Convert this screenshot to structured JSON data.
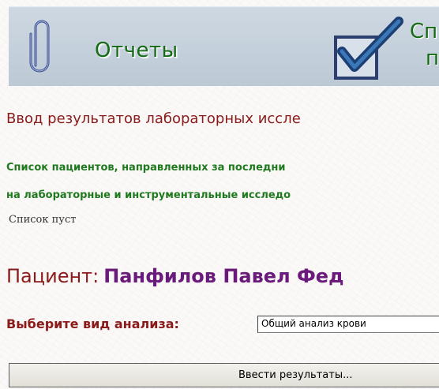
{
  "topbar": {
    "reports_label": "Отчеты",
    "list_label_line1": "Сп",
    "list_label_line2": "па"
  },
  "main": {
    "section_title": "Ввод результатов лабораторных иссле",
    "subhead_line1": "Список пациентов, направленных за последни",
    "subhead_line2": "на лабораторные и инструментальные исследо",
    "empty_text": "Список пуст",
    "patient_label": "Пациент:",
    "patient_name": "Панфилов Павел Фед",
    "analysis_label": "Выберите вид анализа:",
    "analysis_selected": "Общий анализ крови",
    "submit_label": "Ввести результаты..."
  },
  "icons": {
    "reports": "paperclip-icon",
    "list": "checkbox-icon"
  },
  "colors": {
    "nav_text": "#156b15",
    "heading": "#8b1a1a",
    "subheading": "#1f7a1f",
    "patient_name": "#6a1a7a",
    "topbar": "#c5d0db"
  }
}
